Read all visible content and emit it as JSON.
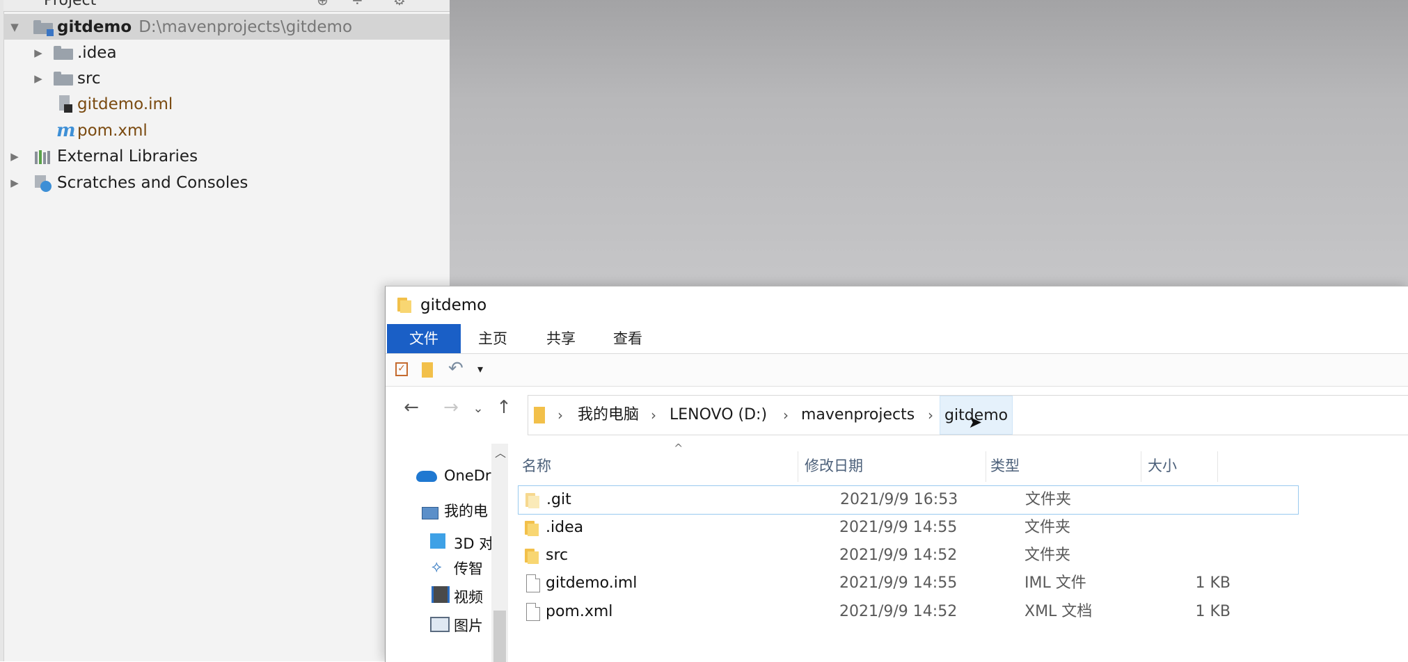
{
  "ide": {
    "panel_title": "Project",
    "tree": [
      {
        "label": "gitdemo",
        "path": "D:\\mavenprojects\\gitdemo",
        "icon": "module-folder-icon",
        "expanded": true,
        "selected": true
      },
      {
        "label": ".idea",
        "icon": "folder-icon",
        "expanded": false
      },
      {
        "label": "src",
        "icon": "folder-icon",
        "expanded": false
      },
      {
        "label": "gitdemo.iml",
        "icon": "iml-file-icon"
      },
      {
        "label": "pom.xml",
        "icon": "maven-icon"
      },
      {
        "label": "External Libraries",
        "icon": "libraries-icon",
        "expanded": false
      },
      {
        "label": "Scratches and Consoles",
        "icon": "scratches-icon",
        "expanded": false
      }
    ]
  },
  "explorer": {
    "window_title": "gitdemo",
    "ribbon_tabs": [
      "文件",
      "主页",
      "共享",
      "查看"
    ],
    "breadcrumb": [
      "我的电脑",
      "LENOVO (D:)",
      "mavenprojects",
      "gitdemo"
    ],
    "nav_pane": [
      "OneDr",
      "我的电",
      "3D 对",
      "传智",
      "视频",
      "图片"
    ],
    "columns": {
      "name": "名称",
      "modified": "修改日期",
      "type": "类型",
      "size": "大小"
    },
    "files": [
      {
        "name": ".git",
        "modified": "2021/9/9 16:53",
        "type": "文件夹",
        "size": "",
        "icon": "folder-icon",
        "selected": true
      },
      {
        "name": ".idea",
        "modified": "2021/9/9 14:55",
        "type": "文件夹",
        "size": "",
        "icon": "folder-icon"
      },
      {
        "name": "src",
        "modified": "2021/9/9 14:52",
        "type": "文件夹",
        "size": "",
        "icon": "folder-icon"
      },
      {
        "name": "gitdemo.iml",
        "modified": "2021/9/9 14:55",
        "type": "IML 文件",
        "size": "1 KB",
        "icon": "file-icon"
      },
      {
        "name": "pom.xml",
        "modified": "2021/9/9 14:52",
        "type": "XML 文档",
        "size": "1 KB",
        "icon": "file-icon"
      }
    ]
  },
  "colors": {
    "ribbon_file_tab": "#1a5fc6",
    "ide_selection": "#d4d4d4",
    "iml_text": "#7a4a10"
  }
}
